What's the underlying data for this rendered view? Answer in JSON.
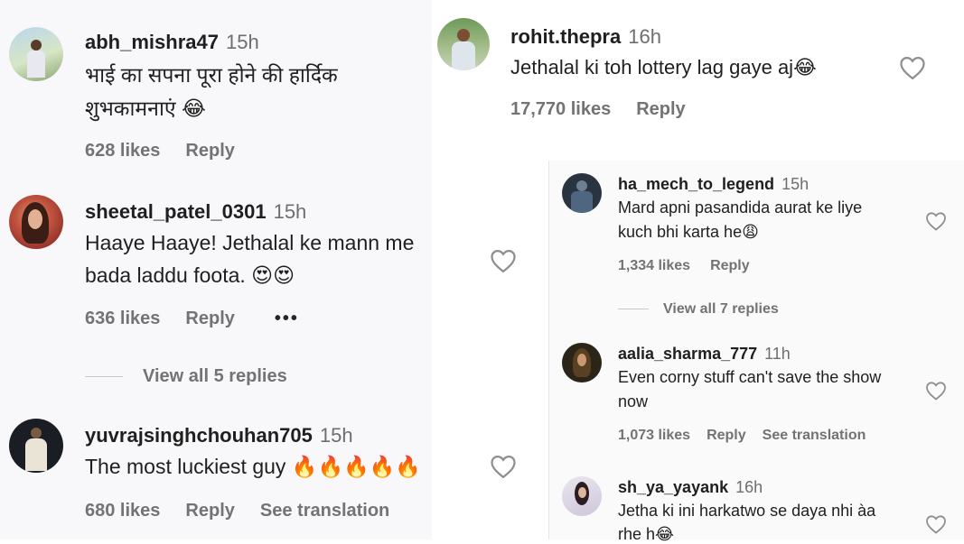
{
  "left": {
    "comments": [
      {
        "username": "abh_mishra47",
        "time": "15h",
        "text_lines": [
          "भाई का सपना पूरा होने की हार्दिक",
          "शुभकामनाएं 😂"
        ],
        "likes": "628 likes",
        "reply": "Reply"
      },
      {
        "username": "sheetal_patel_0301",
        "time": "15h",
        "text_lines": [
          "Haaye Haaye! Jethalal ke mann me",
          "bada laddu foota. 😍😍"
        ],
        "likes": "636 likes",
        "reply": "Reply",
        "more": "•••",
        "view_replies": "View all 5 replies"
      },
      {
        "username": "yuvrajsinghchouhan705",
        "time": "15h",
        "text_lines": [
          "The most luckiest guy 🔥🔥🔥🔥🔥"
        ],
        "likes": "680 likes",
        "reply": "Reply",
        "see_translation": "See translation"
      }
    ]
  },
  "top_right": {
    "username": "rohit.thepra",
    "time": "16h",
    "text": "Jethalal ki toh lottery lag gaye aj😂",
    "likes": "17,770 likes",
    "reply": "Reply"
  },
  "bottom_right": {
    "comments": [
      {
        "username": "ha_mech_to_legend",
        "time": "15h",
        "text_lines": [
          "Mard apni pasandida aurat ke liye",
          "kuch bhi karta he😩"
        ],
        "likes": "1,334 likes",
        "reply": "Reply",
        "view_replies": "View all 7 replies"
      },
      {
        "username": "aalia_sharma_777",
        "time": "11h",
        "text_lines": [
          "Even corny stuff can't save the show",
          "now"
        ],
        "likes": "1,073 likes",
        "reply": "Reply",
        "see_translation": "See translation"
      },
      {
        "username": "sh_ya_yayank",
        "time": "16h",
        "text_lines": [
          "Jetha ki ini harkatwo se daya nhi àa",
          "rhe h😂"
        ]
      }
    ]
  },
  "colors": {
    "text": "#1f1f1f",
    "muted": "#737373",
    "panel": "#f7f7f9"
  },
  "icons": [
    "heart-icon",
    "more-icon"
  ]
}
